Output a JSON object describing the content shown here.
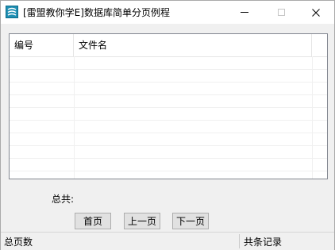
{
  "window": {
    "title": "[雷盟教你学E]数据库简单分页例程",
    "icon": "app-icon"
  },
  "titlebar_controls": {
    "minimize_icon": "minimize-icon",
    "maximize_icon": "maximize-icon",
    "close_icon": "close-icon"
  },
  "list": {
    "columns": [
      "编号",
      "文件名"
    ],
    "rows": []
  },
  "total": {
    "label": "总共:"
  },
  "pager": {
    "first_label": "首页",
    "prev_label": "上一页",
    "next_label": "下一页"
  },
  "statusbar": {
    "left": "总页数",
    "right": "共条记录"
  }
}
